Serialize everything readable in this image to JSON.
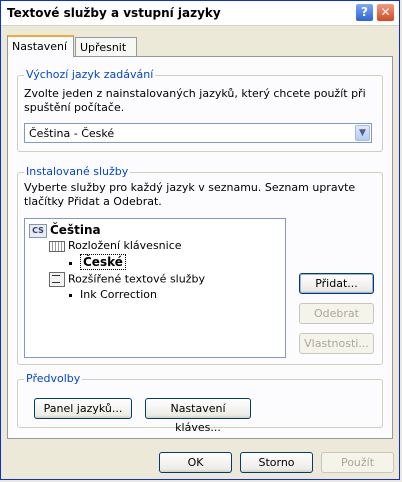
{
  "window": {
    "title": "Textové služby a vstupní jazyky",
    "help_label": "?",
    "close_label": "✕"
  },
  "tabs": [
    {
      "label": "Nastavení",
      "active": true
    },
    {
      "label": "Upřesnit",
      "active": false
    }
  ],
  "default_language": {
    "group_label": "Výchozí jazyk zadávání",
    "description": "Zvolte jeden z nainstalovaných jazyků, který chcete použít při spuštění počítače.",
    "selected": "Čeština - České",
    "dropdown_icon": "chevron-down-icon"
  },
  "installed_services": {
    "group_label": "Instalované služby",
    "description": "Vyberte služby pro každý jazyk v seznamu. Seznam upravte tlačítky Přidat a Odebrat.",
    "tree": {
      "language_badge": "CS",
      "language": "Čeština",
      "keyboard_group": "Rozložení klávesnice",
      "keyboard_item": "České",
      "text_services_group": "Rozšířené textové služby",
      "text_services_item": "Ink Correction"
    },
    "buttons": {
      "add": "Přidat...",
      "remove": "Odebrat",
      "properties": "Vlastnosti..."
    }
  },
  "preferences": {
    "group_label": "Předvolby",
    "language_bar": "Panel jazyků...",
    "key_settings": "Nastavení kláves..."
  },
  "footer": {
    "ok": "OK",
    "cancel": "Storno",
    "apply": "Použít"
  }
}
